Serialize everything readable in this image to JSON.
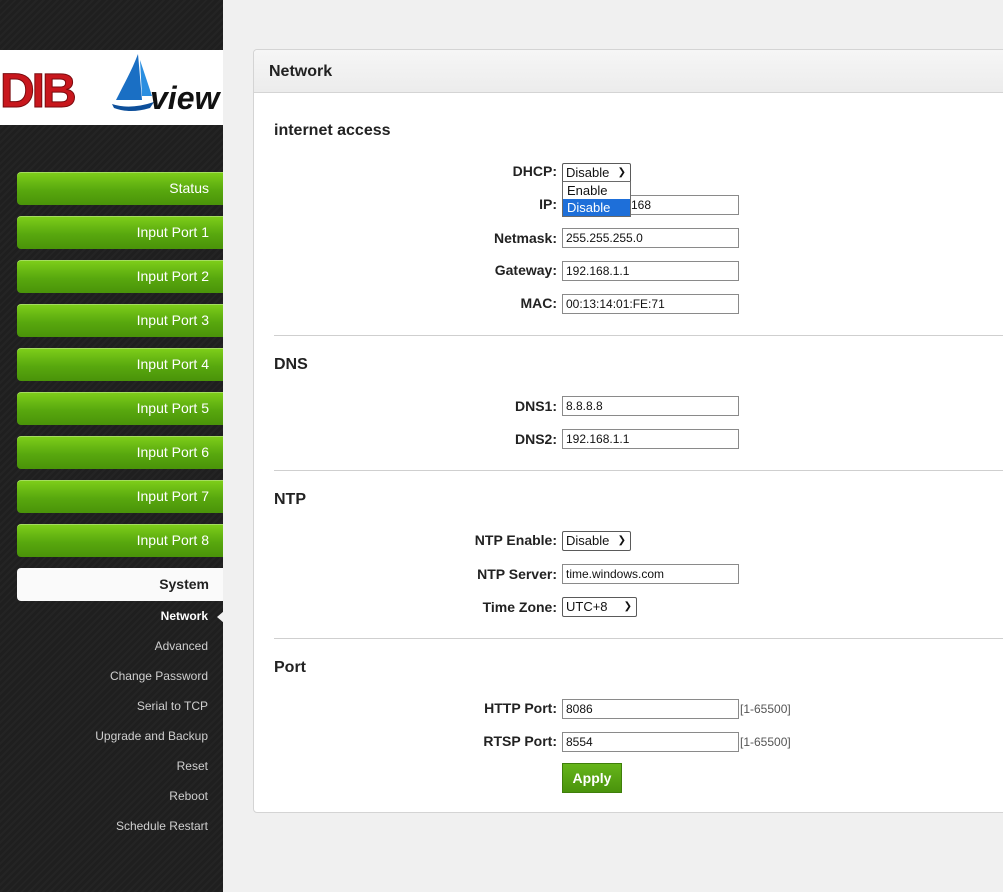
{
  "logo": {
    "brand": "DIB",
    "suffix": "view"
  },
  "nav": {
    "items": [
      "Status",
      "Input Port 1",
      "Input Port 2",
      "Input Port 3",
      "Input Port 4",
      "Input Port 5",
      "Input Port 6",
      "Input Port 7",
      "Input Port 8"
    ],
    "active": "System",
    "sub_items": [
      "Network",
      "Advanced",
      "Change Password",
      "Serial to TCP",
      "Upgrade and Backup",
      "Reset",
      "Reboot",
      "Schedule Restart"
    ],
    "current_sub": "Network"
  },
  "panel": {
    "title": "Network",
    "internet": {
      "title": "internet access",
      "dhcp_label": "DHCP:",
      "dhcp_value": "Disable",
      "dhcp_options": [
        "Enable",
        "Disable"
      ],
      "ip_label": "IP:",
      "ip_value": "168",
      "netmask_label": "Netmask:",
      "netmask_value": "255.255.255.0",
      "gateway_label": "Gateway:",
      "gateway_value": "192.168.1.1",
      "mac_label": "MAC:",
      "mac_value": "00:13:14:01:FE:71"
    },
    "dns": {
      "title": "DNS",
      "dns1_label": "DNS1:",
      "dns1_value": "8.8.8.8",
      "dns2_label": "DNS2:",
      "dns2_value": "192.168.1.1"
    },
    "ntp": {
      "title": "NTP",
      "enable_label": "NTP Enable:",
      "enable_value": "Disable",
      "server_label": "NTP Server:",
      "server_value": "time.windows.com",
      "tz_label": "Time Zone:",
      "tz_value": "UTC+8"
    },
    "port": {
      "title": "Port",
      "http_label": "HTTP Port:",
      "http_value": "8086",
      "http_hint": "[1-65500]",
      "rtsp_label": "RTSP Port:",
      "rtsp_value": "8554",
      "rtsp_hint": "[1-65500]"
    },
    "apply_label": "Apply"
  },
  "colors": {
    "nav_green": "#58a80e",
    "sidebar_bg": "#1f1f1f",
    "logo_red": "#c8171d",
    "select_highlight": "#1e6fd9"
  }
}
